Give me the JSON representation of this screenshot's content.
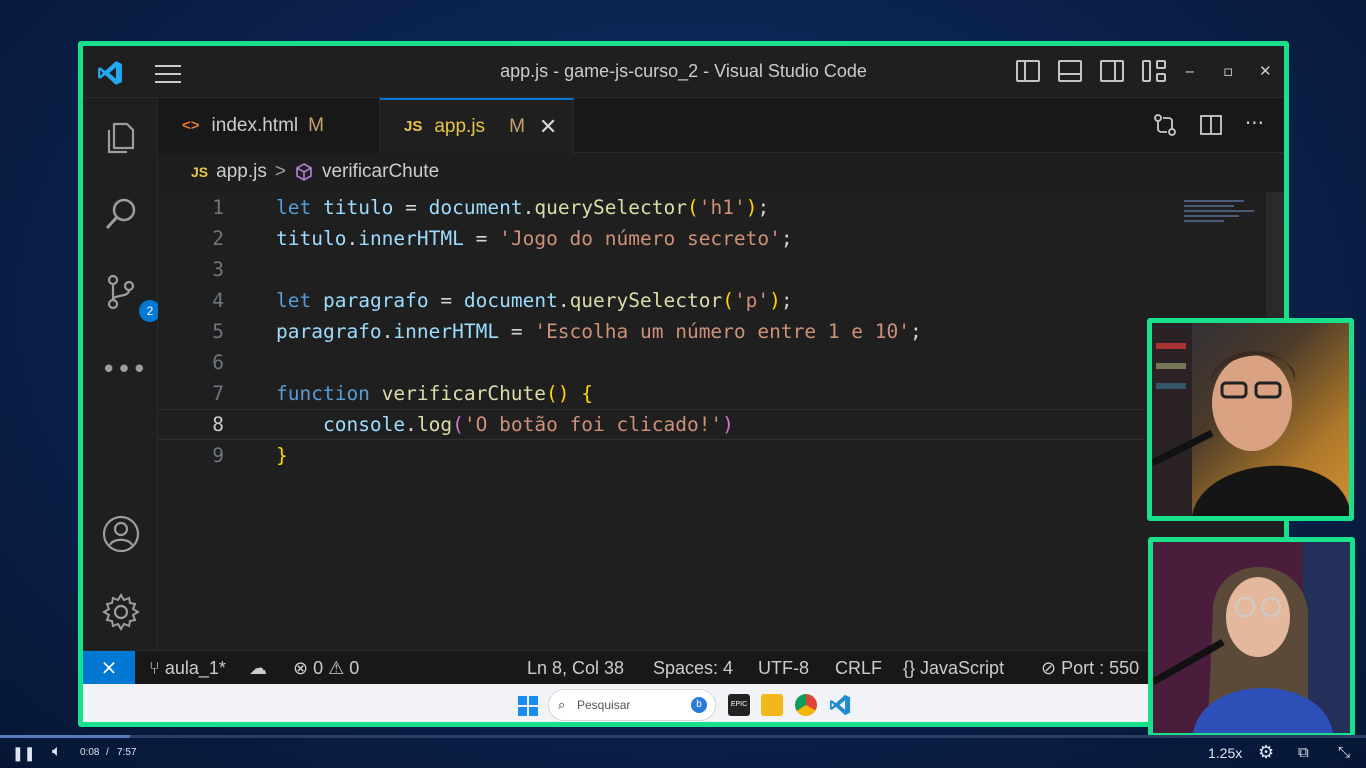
{
  "window": {
    "title": "app.js - game-js-curso_2 - Visual Studio Code",
    "minimize": "‒",
    "maximize": "▫",
    "close": "✕"
  },
  "tabs": [
    {
      "icon": "<>",
      "label": "index.html",
      "status": "M"
    },
    {
      "icon": "JS",
      "label": "app.js",
      "status": "M",
      "close": "✕"
    }
  ],
  "breadcrumb": {
    "file_icon": "JS",
    "file": "app.js",
    "separator": ">",
    "symbol": "verificarChute"
  },
  "activity": {
    "scm_badge": "2"
  },
  "editor": {
    "line_numbers": [
      "1",
      "2",
      "3",
      "4",
      "5",
      "6",
      "7",
      "8",
      "9"
    ],
    "current_line": 8
  },
  "statusbar": {
    "branch": "aula_1*",
    "errors": "0",
    "warnings": "0",
    "position": "Ln 8, Col 38",
    "spaces": "Spaces: 4",
    "encoding": "UTF-8",
    "eol": "CRLF",
    "language": "JavaScript",
    "port": "Port : 550"
  },
  "taskbar": {
    "search_placeholder": "Pesquisar",
    "epic_label": "EPIC"
  },
  "video": {
    "time_current": "0:08",
    "time_sep": "/",
    "time_total": "7:57",
    "speed": "1.25x"
  },
  "colors": {
    "accent": "#19e08a",
    "vscode_blue": "#0078d4",
    "keyword": "#569cd6",
    "string": "#ce9178",
    "function": "#dcdcaa",
    "variable": "#9cdcfe"
  }
}
